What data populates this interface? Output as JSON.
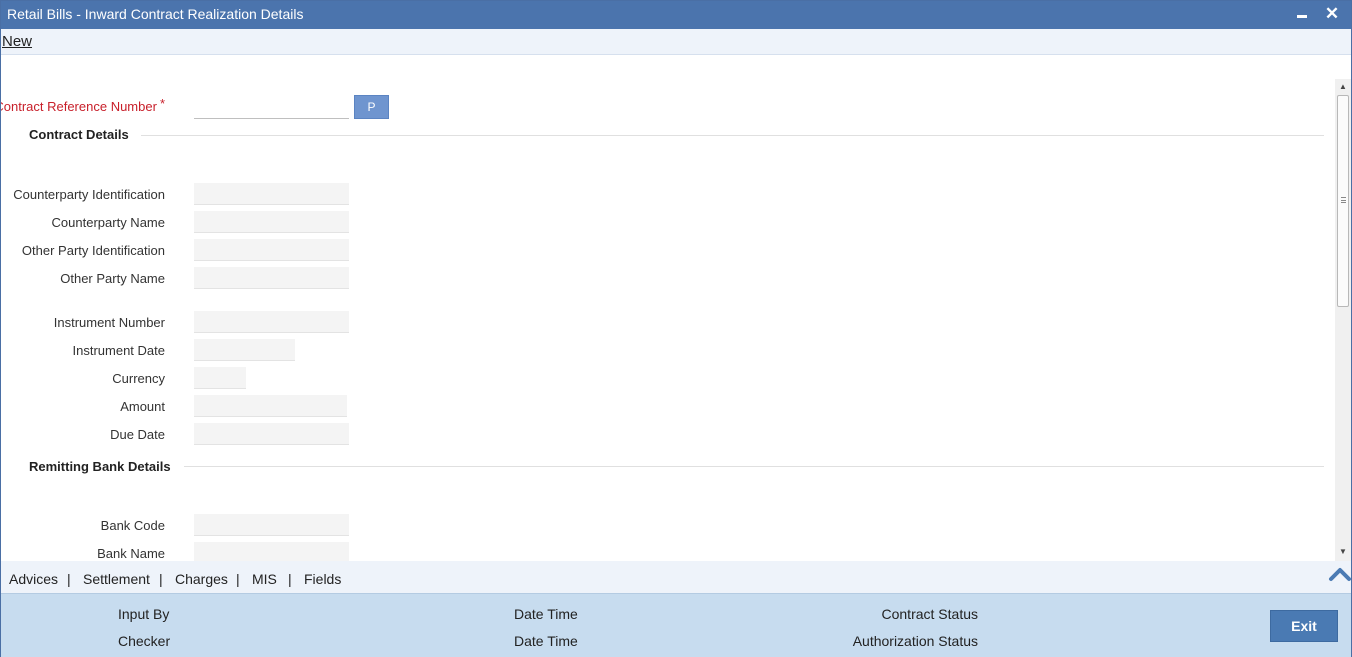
{
  "window": {
    "title": "Retail Bills - Inward Contract Realization Details"
  },
  "menu": {
    "new_label": "New"
  },
  "form": {
    "contract_ref_label": "Contract Reference Number",
    "required_marker": "*",
    "contract_ref_value": "",
    "p_button": "P",
    "contract_details_header": "Contract Details",
    "fields": {
      "counterparty_id": "Counterparty Identification",
      "counterparty_name": "Counterparty Name",
      "other_party_id": "Other Party Identification",
      "other_party_name": "Other Party Name",
      "instrument_number": "Instrument Number",
      "instrument_date": "Instrument Date",
      "currency": "Currency",
      "amount": "Amount",
      "due_date": "Due Date"
    },
    "remitting_bank_header": "Remitting Bank Details",
    "bank_fields": {
      "bank_code": "Bank Code",
      "bank_name": "Bank Name"
    }
  },
  "tabs": [
    "Advices",
    "Settlement",
    "Charges",
    "MIS",
    "Fields"
  ],
  "tab_separator": "|",
  "footer": {
    "input_by": "Input By",
    "checker": "Checker",
    "date_time_1": "Date Time",
    "date_time_2": "Date Time",
    "contract_status": "Contract Status",
    "authorization_status": "Authorization Status",
    "exit": "Exit"
  },
  "colors": {
    "titlebar": "#4b74ad",
    "footer": "#c7dcef",
    "required_label": "#c8202b",
    "button": "#4a7ab3"
  },
  "icons": [
    "minimize-icon",
    "close-icon",
    "chevron-up-icon",
    "scroll-up-arrow-icon",
    "scroll-down-arrow-icon"
  ]
}
